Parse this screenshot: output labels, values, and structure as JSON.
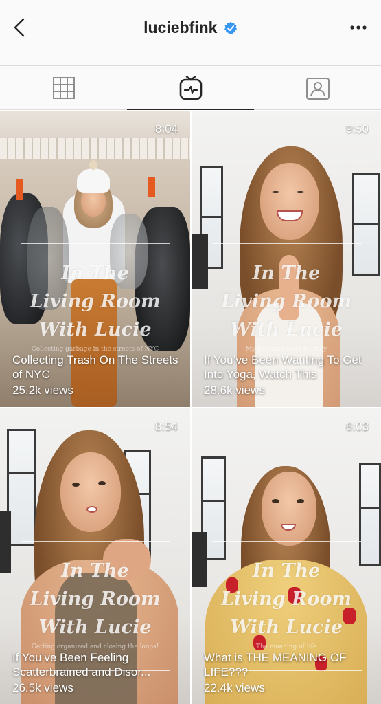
{
  "header": {
    "username": "luciebfink",
    "verified": true,
    "back_icon": "chevron-left-icon",
    "more_icon": "more-horizontal-icon",
    "verified_color": "#3897f0"
  },
  "tabs": [
    {
      "name": "posts",
      "icon": "grid-icon",
      "active": false
    },
    {
      "name": "igtv",
      "icon": "igtv-icon",
      "active": true
    },
    {
      "name": "tagged",
      "icon": "tagged-person-icon",
      "active": false
    }
  ],
  "overlay": {
    "line1": "In The",
    "line2": "Living Room",
    "line3": "With Lucie"
  },
  "videos": [
    {
      "duration": "8:04",
      "title": "Collecting Trash On The Streets of NYC",
      "views": "25.2k views",
      "caption": "Collecting garbage in the streets of NYC"
    },
    {
      "duration": "9:50",
      "title": "If You’ve Been Wanting To Get Into Yoga, Watch This",
      "views": "28.6k views",
      "caption": "My personal yoga journey"
    },
    {
      "duration": "8:54",
      "title": "If You’ve Been Feeling Scatterbrained and Disor...",
      "views": "26.5k views",
      "caption": "Getting organized and closing the loops!"
    },
    {
      "duration": "6:03",
      "title": "What is THE MEANING OF LIFE???",
      "views": "22.4k views",
      "caption": "The meaning of life"
    }
  ]
}
